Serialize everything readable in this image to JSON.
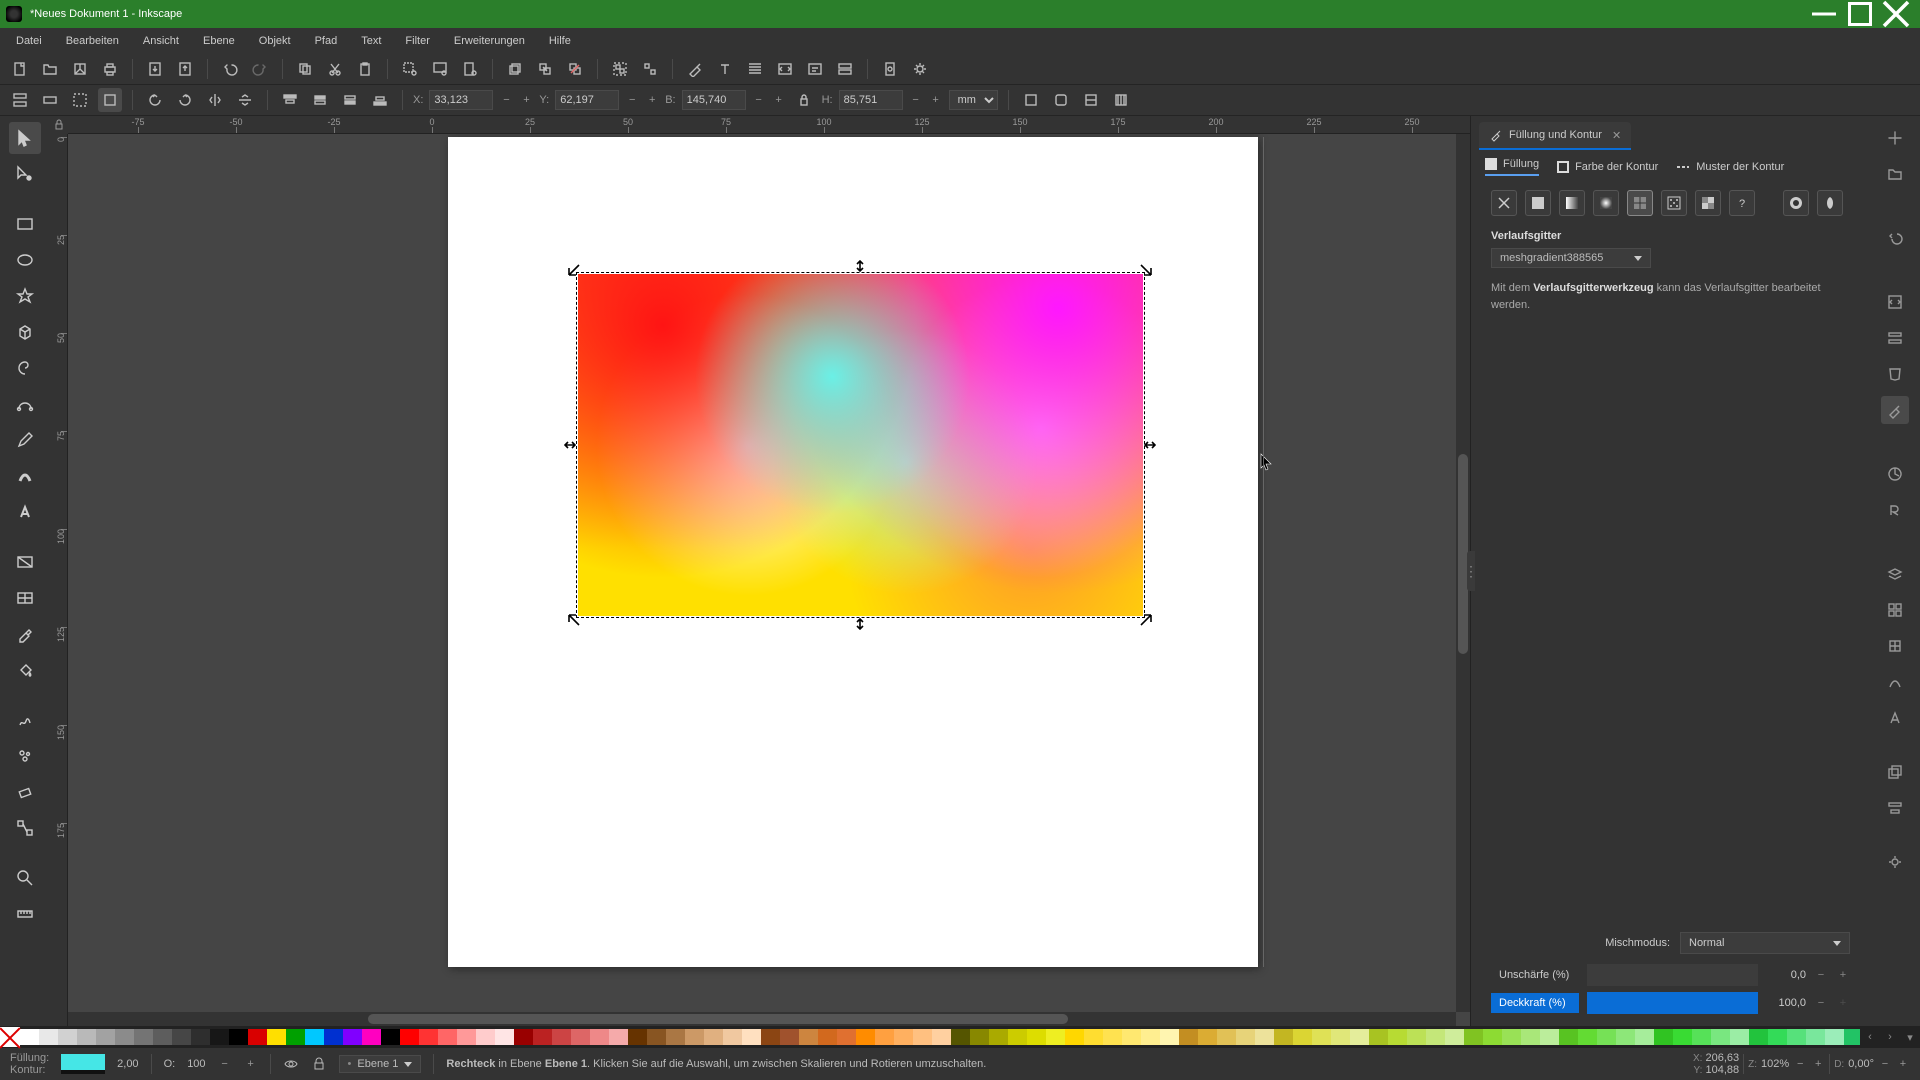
{
  "window": {
    "title": "*Neues Dokument 1 - Inkscape"
  },
  "menu": {
    "items": [
      "Datei",
      "Bearbeiten",
      "Ansicht",
      "Ebene",
      "Objekt",
      "Pfad",
      "Text",
      "Filter",
      "Erweiterungen",
      "Hilfe"
    ]
  },
  "toolbar2": {
    "x_label": "X:",
    "x_value": "33,123",
    "y_label": "Y:",
    "y_value": "62,197",
    "w_label": "B:",
    "w_value": "145,740",
    "h_label": "H:",
    "h_value": "85,751",
    "unit": "mm"
  },
  "ruler": {
    "h_marks": [
      "-75",
      "-50",
      "-25",
      "0",
      "25",
      "50",
      "75",
      "100",
      "125",
      "150",
      "175",
      "200",
      "225",
      "250"
    ],
    "v_marks": [
      "0",
      "25",
      "50",
      "75",
      "100",
      "125",
      "150",
      "175"
    ]
  },
  "panel": {
    "title": "Füllung und Kontur",
    "tabs": {
      "fill": "Füllung",
      "stroke_paint": "Farbe der Kontur",
      "stroke_style": "Muster der Kontur"
    },
    "fill_type_label": "Verlaufsgitter",
    "gradient_name": "meshgradient388565",
    "hint_pre": "Mit dem ",
    "hint_bold": "Verlaufsgitterwerkzeug",
    "hint_post": " kann das Verlaufsgitter bearbeitet werden.",
    "blend_label": "Mischmodus:",
    "blend_value": "Normal",
    "blur_label": "Unschärfe (%)",
    "blur_value": "0,0",
    "opacity_label": "Deckkraft (%)",
    "opacity_value": "100,0"
  },
  "status": {
    "fill_label": "Füllung:",
    "stroke_label": "Kontur:",
    "stroke_width": "2,00",
    "o_label": "O:",
    "opacity": "100",
    "layer_name": "Ebene 1",
    "object_type": "Rechteck",
    "message_a": " in Ebene ",
    "message_layer": "Ebene 1",
    "message_b": ". Klicken Sie auf die Auswahl, um zwischen Skalieren und Rotieren umzuschalten.",
    "coord_x_label": "X:",
    "coord_x": "206,63",
    "coord_y_label": "Y:",
    "coord_y": "104,88",
    "zoom_label": "Z:",
    "zoom": "102%",
    "rot_label": "D:",
    "rot": "0,00°"
  },
  "palette": {
    "gray_count": 12,
    "colors": [
      "#d90000",
      "#ffdf00",
      "#00a000",
      "#00c8ff",
      "#0030d0",
      "#8000ff",
      "#ff00c0",
      "#000000",
      "#ff0000",
      "#ff3333",
      "#ff6666",
      "#ff9999",
      "#ffcccc",
      "#ffe5e5",
      "#990000",
      "#bb2222",
      "#cc4444",
      "#dd6666",
      "#ee8888",
      "#f5aaaa",
      "#663300",
      "#885522",
      "#aa7744",
      "#cc9966",
      "#e0b080",
      "#f0c8a0",
      "#ffe0c0",
      "#8b4513",
      "#a0522d",
      "#cd853f",
      "#d2691e",
      "#e07030",
      "#ff8c00",
      "#ffa040",
      "#ffb060",
      "#ffc080",
      "#ffd0a0",
      "#555500",
      "#888800",
      "#aaaa00",
      "#cccc00",
      "#dddd00",
      "#eeee22",
      "#ffd700",
      "#ffdd30",
      "#ffe250",
      "#ffe870",
      "#ffee90",
      "#fff5b0"
    ]
  }
}
